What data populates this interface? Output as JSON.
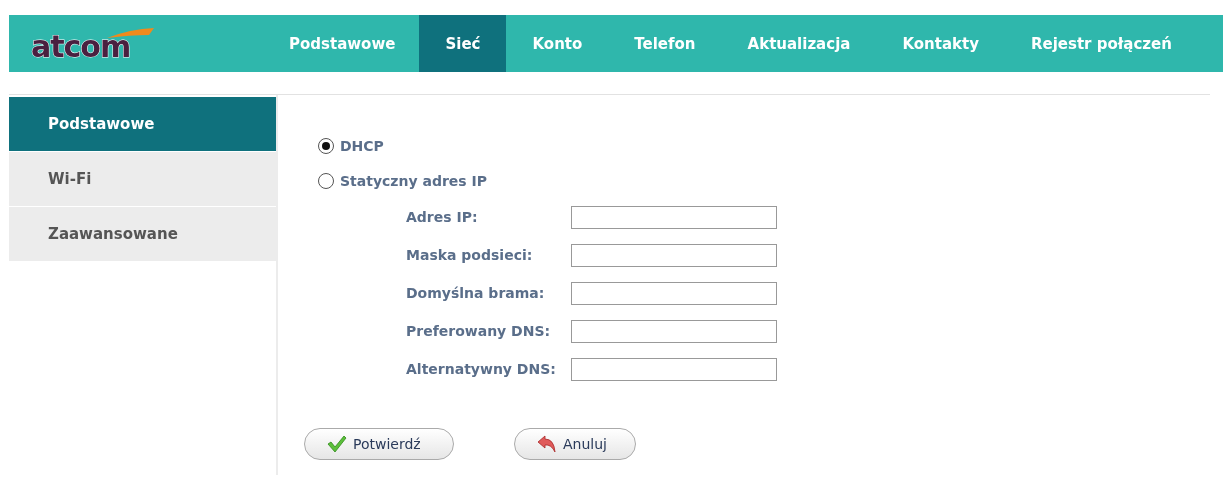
{
  "logo": "atcom",
  "nav": [
    {
      "label": "Podstawowe",
      "selected": false
    },
    {
      "label": "Sieć",
      "selected": true
    },
    {
      "label": "Konto",
      "selected": false
    },
    {
      "label": "Telefon",
      "selected": false
    },
    {
      "label": "Aktualizacja",
      "selected": false
    },
    {
      "label": "Kontakty",
      "selected": false
    },
    {
      "label": "Rejestr połączeń",
      "selected": false
    }
  ],
  "sidebar": {
    "items": [
      {
        "label": "Podstawowe",
        "selected": true
      },
      {
        "label": "Wi-Fi",
        "selected": false
      },
      {
        "label": "Zaawansowane",
        "selected": false
      }
    ]
  },
  "mode": [
    {
      "label": "DHCP",
      "selected": true
    },
    {
      "label": "Statyczny adres IP",
      "selected": false
    }
  ],
  "fields": [
    {
      "label": "Adres IP:"
    },
    {
      "label": "Maska podsieci:"
    },
    {
      "label": "Domyślna brama:"
    },
    {
      "label": "Preferowany DNS:"
    },
    {
      "label": "Alternatywny DNS:"
    }
  ],
  "buttons": [
    {
      "kind": "confirm",
      "label": "Potwierdź"
    },
    {
      "kind": "cancel",
      "label": "Anuluj"
    }
  ]
}
